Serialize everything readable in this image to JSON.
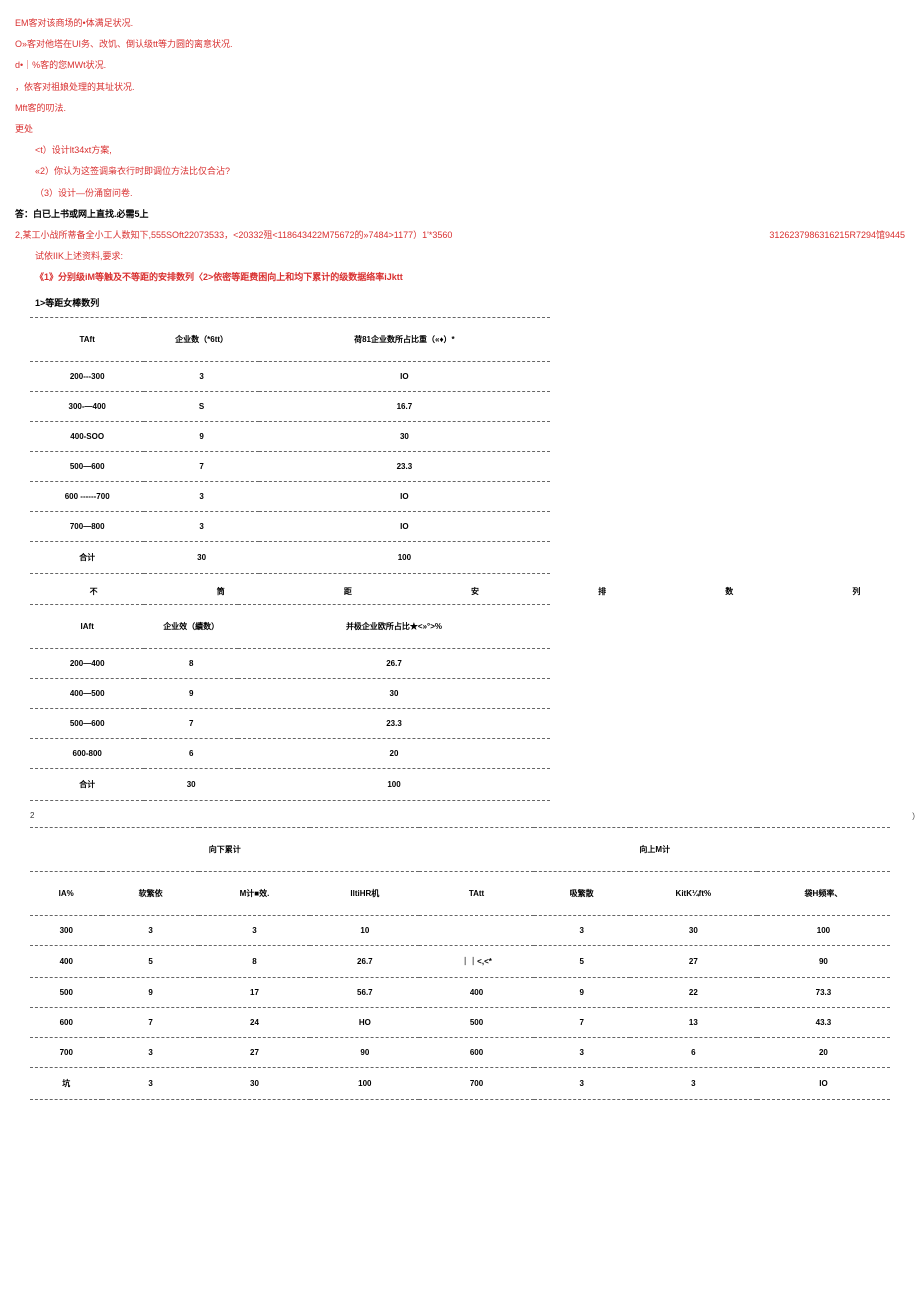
{
  "lines": {
    "l1": "EM客对该商场的•体满足状况.",
    "l2": "O»客对他塔在UI务、改饥、倒认级tt等力圆的离意状况.",
    "l3": "d•｜%客的您MWt状况.",
    "l4": "，依客对祖娘处理的其址状况.",
    "l5": "Mft客的叨法.",
    "l6": "更处",
    "l7": "<t）设计lt34xt方案,",
    "l8": "«2）你认为这签调枭衣行时即调位方法比仅合沾?",
    "l9": "（3）设计—份涌窗问卷.",
    "l10": "答：白已上书或网上直找.必需5上",
    "l11a": "2,某工小战所蒂备全小工人数知下,555SOft22073533，<20332殂<118643422M75672的»7484>1177）1'*3560",
    "l11b": "3126237986316215R7294馆9445",
    "l12": "试依IIK上述资料,要求:",
    "l13": "《1》分别级iM等触及不等距的安排数列〈2>依密等距费困向上和均下累计的级数据络率iJktt",
    "l14": "1>等距女棒数列"
  },
  "table1": {
    "headers": [
      "TAft",
      "企业数（*6tt）",
      "荷81企业数所占比重（«♦）*"
    ],
    "rows": [
      [
        "200---300",
        "3",
        "IO"
      ],
      [
        "300-—400",
        "S",
        "16.7"
      ],
      [
        "400-SOO",
        "9",
        "30"
      ],
      [
        "500—600",
        "7",
        "23.3"
      ],
      [
        "600 ------700",
        "3",
        "IO"
      ],
      [
        "700—800",
        "3",
        "IO"
      ],
      [
        "合计",
        "30",
        "100"
      ]
    ]
  },
  "spread1": [
    "不",
    "筒",
    "距",
    "安",
    "排",
    "数",
    "列"
  ],
  "table2": {
    "headers": [
      "IAft",
      "企业效（續数）",
      "并极企业欧所占比★<»°>%"
    ],
    "rows": [
      [
        "200—400",
        "8",
        "26.7"
      ],
      [
        "400—500",
        "9",
        "30"
      ],
      [
        "500—600",
        "7",
        "23.3"
      ],
      [
        "600-800",
        "6",
        "20"
      ],
      [
        "合计",
        "30",
        "100"
      ]
    ]
  },
  "spread2a": "2",
  "spread2b": "）",
  "table3": {
    "top_headers": [
      "向下累计",
      "向上M计"
    ],
    "headers": [
      "IA%",
      "软繁依",
      "M计■效.",
      "IltiHR机",
      "TAtt",
      "吸繁散",
      "KitK¼ft%",
      "袋H频率、"
    ],
    "rows": [
      [
        "300",
        "3",
        "3",
        "10",
        "",
        "3",
        "30",
        "100"
      ],
      [
        "400",
        "5",
        "8",
        "26.7",
        "｜｜<,<*",
        "5",
        "27",
        "90"
      ],
      [
        "500",
        "9",
        "17",
        "56.7",
        "400",
        "9",
        "22",
        "73.3"
      ],
      [
        "600",
        "7",
        "24",
        "HO",
        "500",
        "7",
        "13",
        "43.3"
      ],
      [
        "700",
        "3",
        "27",
        "90",
        "600",
        "3",
        "6",
        "20"
      ],
      [
        "坑",
        "3",
        "30",
        "100",
        "700",
        "3",
        "3",
        "IO"
      ]
    ]
  }
}
